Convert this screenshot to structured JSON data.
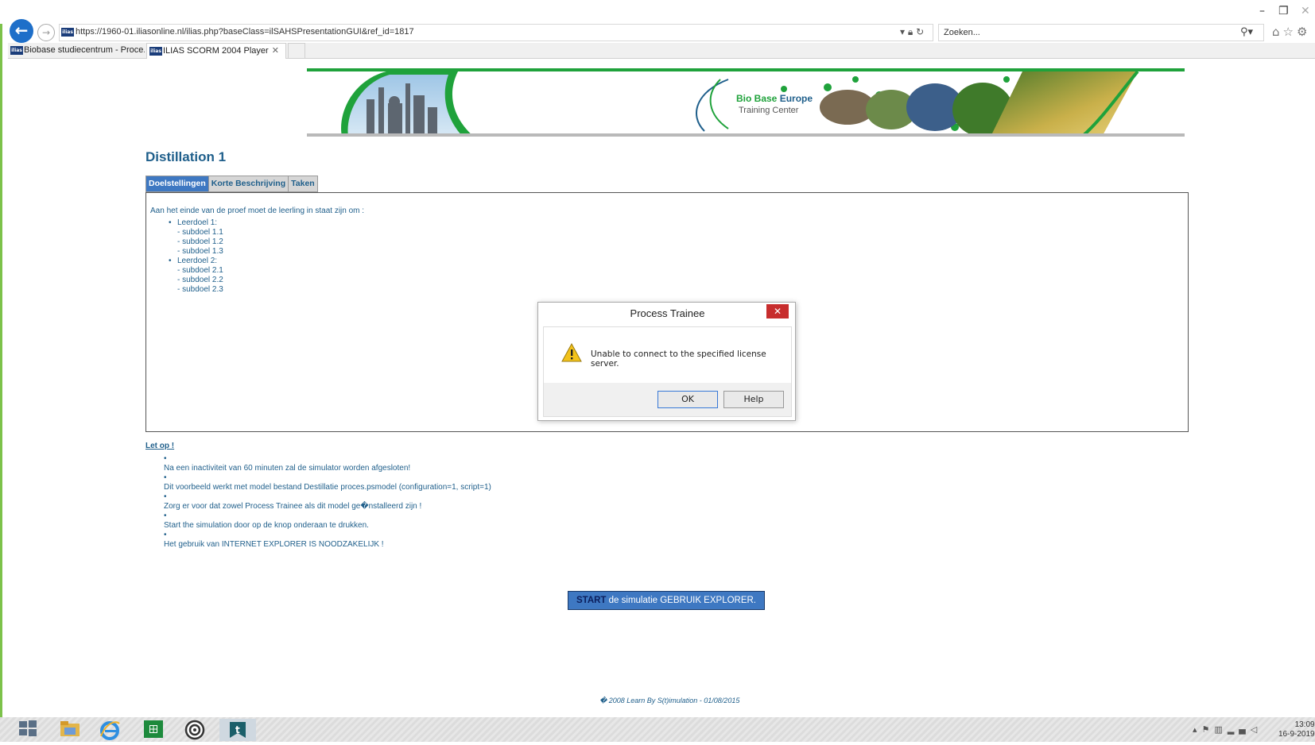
{
  "browser": {
    "url": "https://1960-01.iliasonline.nl/ilias.php?baseClass=ilSAHSPresentationGUI&ref_id=1817",
    "search_placeholder": "Zoeken...",
    "favicon_label": "ilias",
    "tabs": [
      {
        "label": "Biobase studiecentrum - Proce...",
        "active": false
      },
      {
        "label": "ILIAS SCORM 2004 Player",
        "active": true
      }
    ]
  },
  "banner": {
    "brand_line1_a": "Bio Base",
    "brand_line1_b": "Europe",
    "brand_line2": "Training Center"
  },
  "page": {
    "title": "Distillation 1",
    "tabs": [
      {
        "label": "Doelstellingen",
        "active": true
      },
      {
        "label": "Korte Beschrijving",
        "active": false
      },
      {
        "label": "Taken",
        "active": false
      }
    ],
    "intro": "Aan het einde van de proef moet de leerling in staat zijn om :",
    "goals": [
      {
        "label": "Leerdoel 1:",
        "subs": [
          "- subdoel 1.1",
          "- subdoel 1.2",
          "- subdoel 1.3"
        ]
      },
      {
        "label": "Leerdoel 2:",
        "subs": [
          "- subdoel 2.1",
          "- subdoel 2.2",
          "- subdoel 2.3"
        ]
      }
    ],
    "notice_heading": "Let op !",
    "notices": [
      "Na een inactiviteit van 60 minuten zal de simulator worden afgesloten!",
      "Dit voorbeeld werkt met model bestand Destillatie proces.psmodel (configuration=1, script=1)",
      "Zorg er voor dat zowel Process Trainee als dit model ge�nstalleerd zijn !",
      "Start the simulation door op de knop onderaan te drukken.",
      "Het gebruik van INTERNET EXPLORER IS NOODZAKELIJK !"
    ],
    "start_bold": "START",
    "start_rest": " de simulatie GEBRUIK EXPLORER.",
    "footer": "� 2008 Learn By S(t)imulation - 01/08/2015"
  },
  "dialog": {
    "title": "Process Trainee",
    "message": "Unable to connect to the specified license server.",
    "ok_label": "OK",
    "help_label": "Help"
  },
  "taskbar": {
    "time": "13:09",
    "date": "16-9-2019"
  },
  "colors": {
    "accent_blue": "#3e78c2",
    "text_blue": "#1f5f8b",
    "banner_green": "#1fa23b",
    "window_border_green": "#7cc24a",
    "close_red": "#c72d2d"
  }
}
